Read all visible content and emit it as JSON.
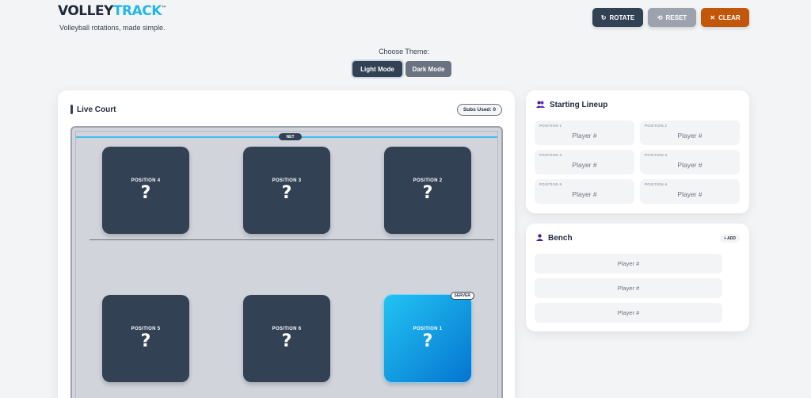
{
  "brand": {
    "name_part1": "VOLLEY",
    "name_part2": "TRACK",
    "trademark": "™",
    "tagline": "Volleyball rotations, made simple."
  },
  "toolbar": {
    "rotate": {
      "icon": "↻",
      "label": "ROTATE"
    },
    "reset": {
      "icon": "⟲",
      "label": "RESET"
    },
    "clear": {
      "icon": "✕",
      "label": "CLEAR"
    }
  },
  "theme": {
    "label": "Choose Theme:",
    "light": "Light Mode",
    "dark": "Dark Mode",
    "selected": "Light Mode"
  },
  "court": {
    "title": "Live Court",
    "subs_used": "Subs Used: 0",
    "net_label": "NET",
    "server_label": "SERVER",
    "positions": [
      {
        "label": "POSITION 4",
        "value": "?"
      },
      {
        "label": "POSITION 3",
        "value": "?"
      },
      {
        "label": "POSITION 2",
        "value": "?"
      },
      {
        "label": "POSITION 5",
        "value": "?"
      },
      {
        "label": "POSITION 6",
        "value": "?"
      },
      {
        "label": "POSITION 1",
        "value": "?"
      }
    ]
  },
  "lineup": {
    "title": "Starting Lineup",
    "icon": "users-icon",
    "slots": [
      {
        "label": "POSITION 1",
        "placeholder": "Player #"
      },
      {
        "label": "POSITION 2",
        "placeholder": "Player #"
      },
      {
        "label": "POSITION 3",
        "placeholder": "Player #"
      },
      {
        "label": "POSITION 4",
        "placeholder": "Player #"
      },
      {
        "label": "POSITION 5",
        "placeholder": "Player #"
      },
      {
        "label": "POSITION 6",
        "placeholder": "Player #"
      }
    ]
  },
  "bench": {
    "title": "Bench",
    "icon": "user-icon",
    "add_label": "+ ADD",
    "items": [
      "Player #",
      "Player #",
      "Player #"
    ]
  },
  "colors": {
    "accent": "#22b8e6",
    "dark": "#334155",
    "clear": "#c2570c",
    "server_gradient_start": "#22c3f3",
    "server_gradient_end": "#0575d0"
  }
}
